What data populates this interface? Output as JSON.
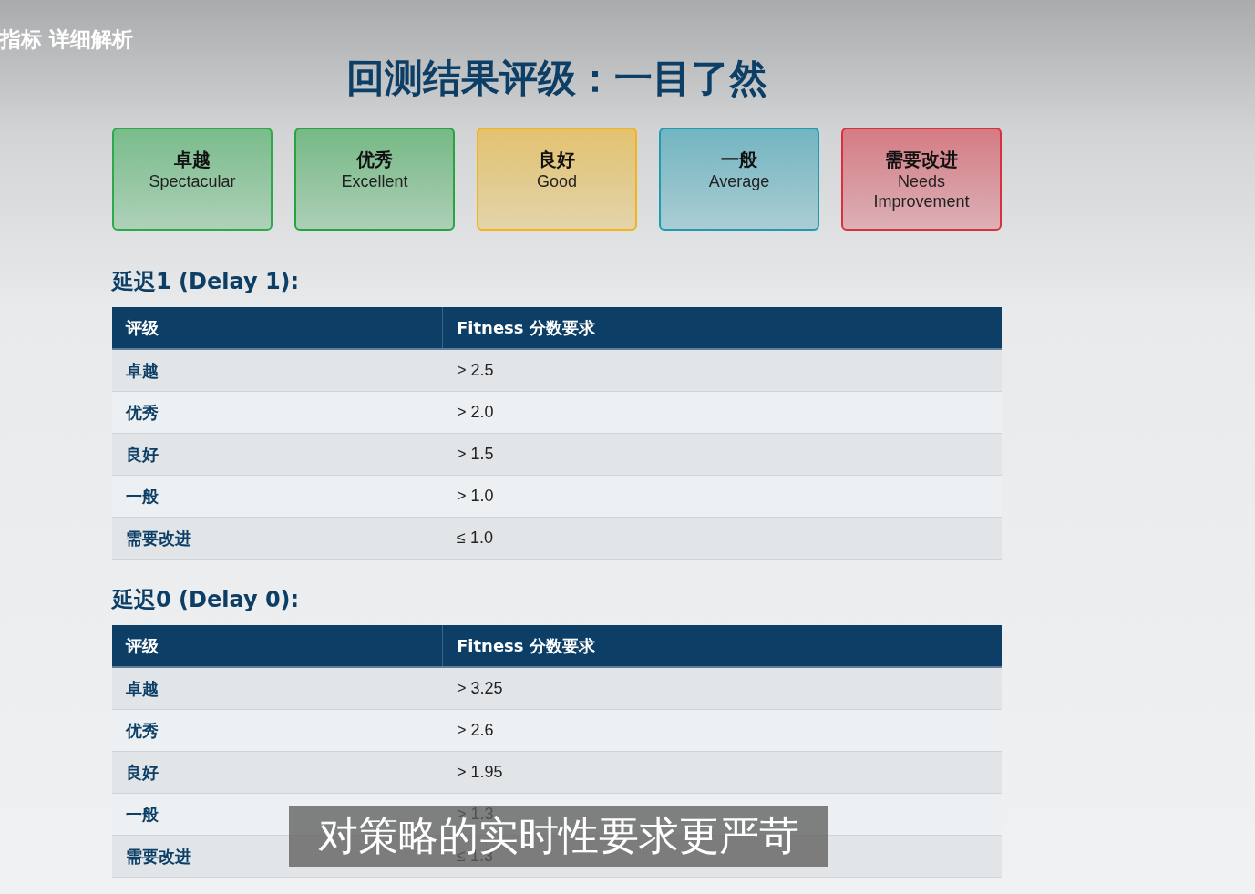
{
  "chapter_label": "指标 详细解析",
  "title": "回测结果评级：一目了然",
  "grade_cards": [
    {
      "zh": "卓越",
      "en": "Spectacular",
      "color": "#2ea84a"
    },
    {
      "zh": "优秀",
      "en": "Excellent",
      "color": "#27a33f"
    },
    {
      "zh": "良好",
      "en": "Good",
      "color": "#f2b418"
    },
    {
      "zh": "一般",
      "en": "Average",
      "color": "#1f9bb0"
    },
    {
      "zh": "需要改进",
      "en": "Needs Improvement",
      "color": "#d8303e"
    }
  ],
  "sections": [
    {
      "heading": "延迟1 (Delay 1):",
      "columns": [
        "评级",
        "Fitness 分数要求"
      ],
      "rows": [
        {
          "grade": "卓越",
          "requirement": "> 2.5"
        },
        {
          "grade": "优秀",
          "requirement": "> 2.0"
        },
        {
          "grade": "良好",
          "requirement": "> 1.5"
        },
        {
          "grade": "一般",
          "requirement": "> 1.0"
        },
        {
          "grade": "需要改进",
          "requirement": "≤ 1.0"
        }
      ]
    },
    {
      "heading": "延迟0 (Delay 0):",
      "columns": [
        "评级",
        "Fitness 分数要求"
      ],
      "rows": [
        {
          "grade": "卓越",
          "requirement": "> 3.25"
        },
        {
          "grade": "优秀",
          "requirement": "> 2.6"
        },
        {
          "grade": "良好",
          "requirement": "> 1.95"
        },
        {
          "grade": "一般",
          "requirement": "> 1.3"
        },
        {
          "grade": "需要改进",
          "requirement": "≤ 1.3"
        }
      ]
    }
  ],
  "subtitle": "对策略的实时性要求更严苛"
}
